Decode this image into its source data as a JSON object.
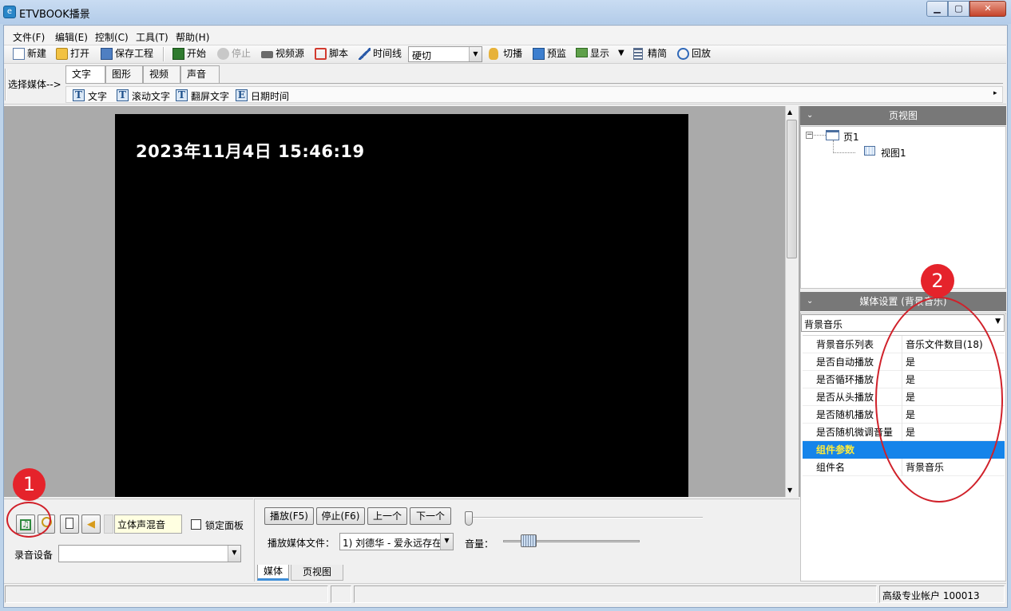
{
  "window": {
    "title": "ETVBOOK播景",
    "app_icon": "e-logo-icon",
    "min": "▁",
    "max": "▢",
    "close": "✕"
  },
  "menu": [
    "文件(F)",
    "编辑(E)",
    "控制(C)",
    "工具(T)",
    "帮助(H)"
  ],
  "toolbar": {
    "new": "新建",
    "open": "打开",
    "save_project": "保存工程",
    "start": "开始",
    "stop": "停止",
    "video_source": "视频源",
    "script": "脚本",
    "timeline": "时间线",
    "transition": "硬切",
    "cut": "切播",
    "preview": "预监",
    "display": "显示",
    "simplify": "精简",
    "replay": "回放"
  },
  "media_select": {
    "label": "选择媒体-->",
    "tabs": [
      "文字",
      "图形",
      "视频",
      "声音"
    ],
    "subitems": [
      "文字",
      "滚动文字",
      "翻屏文字",
      "日期时间"
    ]
  },
  "preview": {
    "clock_text": "2023年11月4日   15:46:19"
  },
  "page_view": {
    "header": "页视图",
    "tree": {
      "page": "页1",
      "view": "视图1"
    }
  },
  "media_settings": {
    "header": "媒体设置 (背景音乐)",
    "selected": "背景音乐",
    "rows": [
      {
        "k": "背景音乐列表",
        "v": "音乐文件数目(18)"
      },
      {
        "k": "是否自动播放",
        "v": "是"
      },
      {
        "k": "是否循环播放",
        "v": "是"
      },
      {
        "k": "是否从头播放",
        "v": "是"
      },
      {
        "k": "是否随机播放",
        "v": "是"
      },
      {
        "k": "是否随机微调音量",
        "v": "是"
      }
    ],
    "section": "组件参数",
    "component": {
      "k": "组件名",
      "v": "背景音乐"
    }
  },
  "audio_panel": {
    "mix_mode": "立体声混音",
    "lock_panel": "锁定面板",
    "record_device_label": "录音设备",
    "record_device_value": ""
  },
  "player_panel": {
    "play": "播放(F5)",
    "stop": "停止(F6)",
    "prev": "上一个",
    "next": "下一个",
    "media_file_label": "播放媒体文件：",
    "media_file_value": "1)  刘德华 - 爱永远存在",
    "volume_label": "音量：",
    "tabs": [
      "媒体",
      "页视图"
    ]
  },
  "statusbar": {
    "account": "高级专业帐户 100013"
  },
  "annotations": {
    "badge1": "1",
    "badge2": "2",
    "color": "#e5232b"
  }
}
